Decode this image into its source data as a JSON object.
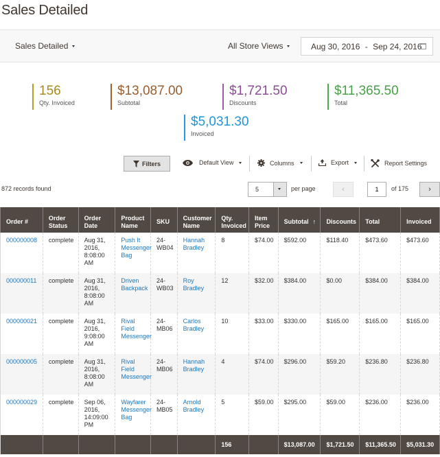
{
  "page": {
    "title": "Sales Detailed"
  },
  "filter_bar": {
    "report_label": "Sales Detailed",
    "store_label": "All Store Views",
    "date_from": "Aug 30, 2016",
    "date_sep": "-",
    "date_to": "Sep 24, 2016"
  },
  "kpis": {
    "qty": {
      "value": "156",
      "label": "Qty. Invoiced",
      "color": "#a58a1c"
    },
    "subtotal": {
      "value": "$13,087.00",
      "label": "Subtotal",
      "color": "#9a5d2e"
    },
    "discounts": {
      "value": "$1,721.50",
      "label": "Discounts",
      "color": "#8e4b98"
    },
    "total": {
      "value": "$11,365.50",
      "label": "Total",
      "color": "#479f48"
    },
    "invoiced": {
      "value": "$5,031.30",
      "label": "Invoiced",
      "color": "#1e95da"
    }
  },
  "toolbar": {
    "filters": "Filters",
    "default_view": "Default View",
    "columns": "Columns",
    "export": "Export",
    "report_settings": "Report Settings"
  },
  "pager": {
    "records": "872 records found",
    "per_page_value": "5",
    "per_page_label": "per page",
    "prev": "‹",
    "current_page": "1",
    "of_pages": "of 175",
    "next": "›"
  },
  "table": {
    "headers": [
      "Order #",
      "Order Status",
      "Order Date",
      "Product Name",
      "SKU",
      "Customer Name",
      "Qty. Invoiced",
      "Item Price",
      "Subtotal",
      "Discounts",
      "Total",
      "Invoiced"
    ],
    "sorted_column_arrow": "↑",
    "rows": [
      {
        "order": "000000008",
        "status": "complete",
        "date": "Aug 31, 2016, 8:08:00 AM",
        "product": "Push It Messenger Bag",
        "sku": "24-WB04",
        "customer": "Hannah Bradley",
        "qty": "8",
        "price": "$74.00",
        "subtotal": "$592.00",
        "discounts": "$118.40",
        "total": "$473.60",
        "invoiced": "$473.60"
      },
      {
        "order": "000000011",
        "status": "complete",
        "date": "Aug 31, 2016, 8:08:00 AM",
        "product": "Driven Backpack",
        "sku": "24-WB03",
        "customer": "Roy Bradley",
        "qty": "12",
        "price": "$32.00",
        "subtotal": "$384.00",
        "discounts": "$0.00",
        "total": "$384.00",
        "invoiced": "$384.00"
      },
      {
        "order": "000000021",
        "status": "complete",
        "date": "Aug 31, 2016, 9:08:00 AM",
        "product": "Rival Field Messenger",
        "sku": "24-MB06",
        "customer": "Carlos Bradley",
        "qty": "10",
        "price": "$33.00",
        "subtotal": "$330.00",
        "discounts": "$165.00",
        "total": "$165.00",
        "invoiced": "$165.00"
      },
      {
        "order": "000000005",
        "status": "complete",
        "date": "Aug 31, 2016, 8:08:00 AM",
        "product": "Rival Field Messenger",
        "sku": "24-MB06",
        "customer": "Hannah Bradley",
        "qty": "4",
        "price": "$74.00",
        "subtotal": "$296.00",
        "discounts": "$59.20",
        "total": "$236.80",
        "invoiced": "$236.80"
      },
      {
        "order": "000000029",
        "status": "complete",
        "date": "Sep 06, 2016, 14:09:00 PM",
        "product": "Wayfarer Messenger Bag",
        "sku": "24-MB05",
        "customer": "Arnold Bradley",
        "qty": "5",
        "price": "$59.00",
        "subtotal": "$295.00",
        "discounts": "$59.00",
        "total": "$236.00",
        "invoiced": "$236.00"
      }
    ],
    "totals": {
      "qty": "156",
      "subtotal": "$13,087.00",
      "discounts": "$1,721.50",
      "total": "$11,365.50",
      "invoiced": "$5,031.30"
    }
  }
}
